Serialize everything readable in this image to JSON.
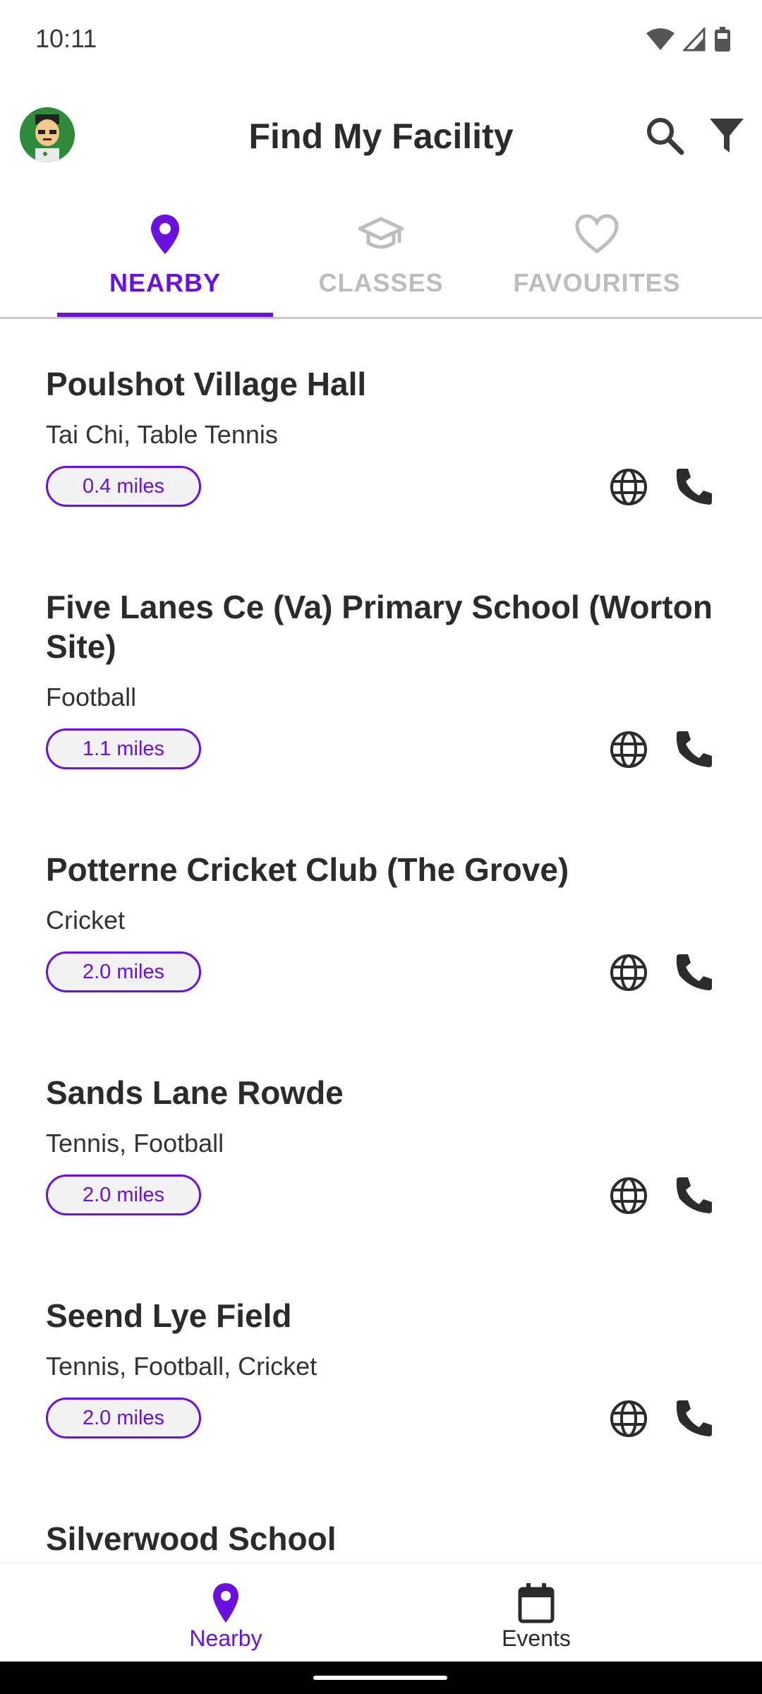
{
  "status": {
    "time": "10:11"
  },
  "app": {
    "title": "Find My Facility"
  },
  "colors": {
    "accent": "#6a11e0",
    "inactive": "#bdbdbd",
    "text": "#2b2b2b"
  },
  "tabs": [
    {
      "label": "NEARBY",
      "icon": "location-pin-icon",
      "active": true
    },
    {
      "label": "CLASSES",
      "icon": "graduation-cap-icon",
      "active": false
    },
    {
      "label": "FAVOURITES",
      "icon": "heart-outline-icon",
      "active": false
    }
  ],
  "facilities": [
    {
      "name": "Poulshot Village Hall",
      "activities": "Tai Chi, Table Tennis",
      "distance": "0.4 miles"
    },
    {
      "name": "Five Lanes Ce (Va) Primary School (Worton Site)",
      "activities": "Football",
      "distance": "1.1 miles"
    },
    {
      "name": "Potterne Cricket Club (The Grove)",
      "activities": "Cricket",
      "distance": "2.0 miles"
    },
    {
      "name": "Sands Lane Rowde",
      "activities": "Tennis, Football",
      "distance": "2.0 miles"
    },
    {
      "name": "Seend Lye Field",
      "activities": "Tennis, Football, Cricket",
      "distance": "2.0 miles"
    },
    {
      "name": "Silverwood School",
      "activities": "",
      "distance": ""
    }
  ],
  "bottom_nav": [
    {
      "label": "Nearby",
      "icon": "location-pin-icon",
      "active": true
    },
    {
      "label": "Events",
      "icon": "calendar-icon",
      "active": false
    }
  ]
}
